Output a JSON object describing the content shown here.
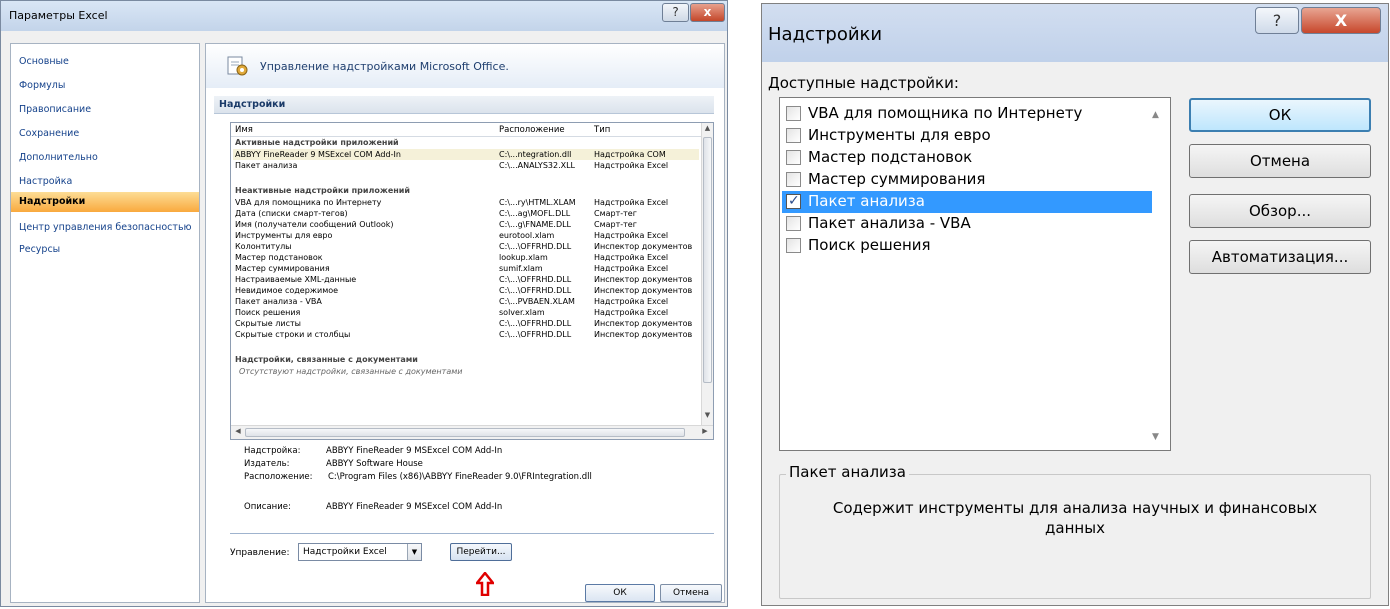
{
  "options_window": {
    "title": "Параметры Excel",
    "help": "?",
    "close": "x",
    "nav": [
      "Основные",
      "Формулы",
      "Правописание",
      "Сохранение",
      "Дополнительно",
      "Настройка",
      "Надстройки",
      "Центр управления безопасностью",
      "Ресурсы"
    ],
    "header": "Управление надстройками Microsoft Office.",
    "section": "Надстройки",
    "columns": {
      "name": "Имя",
      "location": "Расположение",
      "type": "Тип"
    },
    "group_active": "Активные надстройки приложений",
    "active": [
      {
        "name": "ABBYY FineReader 9 MSExcel COM Add-In",
        "location": "C:\\...ntegration.dll",
        "type": "Надстройка COM"
      },
      {
        "name": "Пакет анализа",
        "location": "C:\\...ANALYS32.XLL",
        "type": "Надстройка Excel"
      }
    ],
    "group_inactive": "Неактивные надстройки приложений",
    "inactive": [
      {
        "name": "VBA для помощника по Интернету",
        "location": "C:\\...ry\\HTML.XLAM",
        "type": "Надстройка Excel"
      },
      {
        "name": "Дата (списки смарт-тегов)",
        "location": "C:\\...ag\\MOFL.DLL",
        "type": "Смарт-тег"
      },
      {
        "name": "Имя (получатели сообщений Outlook)",
        "location": "C:\\...g\\FNAME.DLL",
        "type": "Смарт-тег"
      },
      {
        "name": "Инструменты для евро",
        "location": "eurotool.xlam",
        "type": "Надстройка Excel"
      },
      {
        "name": "Колонтитулы",
        "location": "C:\\...\\OFFRHD.DLL",
        "type": "Инспектор документов"
      },
      {
        "name": "Мастер подстановок",
        "location": "lookup.xlam",
        "type": "Надстройка Excel"
      },
      {
        "name": "Мастер суммирования",
        "location": "sumif.xlam",
        "type": "Надстройка Excel"
      },
      {
        "name": "Настраиваемые XML-данные",
        "location": "C:\\...\\OFFRHD.DLL",
        "type": "Инспектор документов"
      },
      {
        "name": "Невидимое содержимое",
        "location": "C:\\...\\OFFRHD.DLL",
        "type": "Инспектор документов"
      },
      {
        "name": "Пакет анализа - VBA",
        "location": "C:\\...PVBAEN.XLAM",
        "type": "Надстройка Excel"
      },
      {
        "name": "Поиск решения",
        "location": "solver.xlam",
        "type": "Надстройка Excel"
      },
      {
        "name": "Скрытые листы",
        "location": "C:\\...\\OFFRHD.DLL",
        "type": "Инспектор документов"
      },
      {
        "name": "Скрытые строки и столбцы",
        "location": "C:\\...\\OFFRHD.DLL",
        "type": "Инспектор документов"
      }
    ],
    "group_doc": "Надстройки, связанные с документами",
    "doc_empty": "Отсутствуют надстройки, связанные с документами",
    "details": {
      "addin_label": "Надстройка:",
      "addin_value": "ABBYY FineReader 9 MSExcel COM Add-In",
      "publisher_label": "Издатель:",
      "publisher_value": "ABBYY Software House",
      "location_label": "Расположение:",
      "location_value": "C:\\Program Files (x86)\\ABBYY FineReader 9.0\\FRIntegration.dll",
      "desc_label": "Описание:",
      "desc_value": "ABBYY FineReader 9 MSExcel COM Add-In"
    },
    "manage_label": "Управление:",
    "manage_value": "Надстройки Excel",
    "go_button": "Перейти...",
    "ok": "ОК",
    "cancel": "Отмена"
  },
  "addins_window": {
    "title": "Надстройки",
    "help": "?",
    "close": "X",
    "available_label": "Доступные надстройки:",
    "items": [
      {
        "label": "VBA для помощника по Интернету",
        "checked": false
      },
      {
        "label": "Инструменты для евро",
        "checked": false
      },
      {
        "label": "Мастер подстановок",
        "checked": false
      },
      {
        "label": "Мастер суммирования",
        "checked": false
      },
      {
        "label": "Пакет анализа",
        "checked": true
      },
      {
        "label": "Пакет анализа - VBA",
        "checked": false
      },
      {
        "label": "Поиск решения",
        "checked": false
      }
    ],
    "ok": "ОК",
    "cancel": "Отмена",
    "browse": "Обзор...",
    "automation": "Автоматизация...",
    "desc_title": "Пакет анализа",
    "desc_text": "Содержит инструменты для анализа научных и финансовых данных"
  }
}
